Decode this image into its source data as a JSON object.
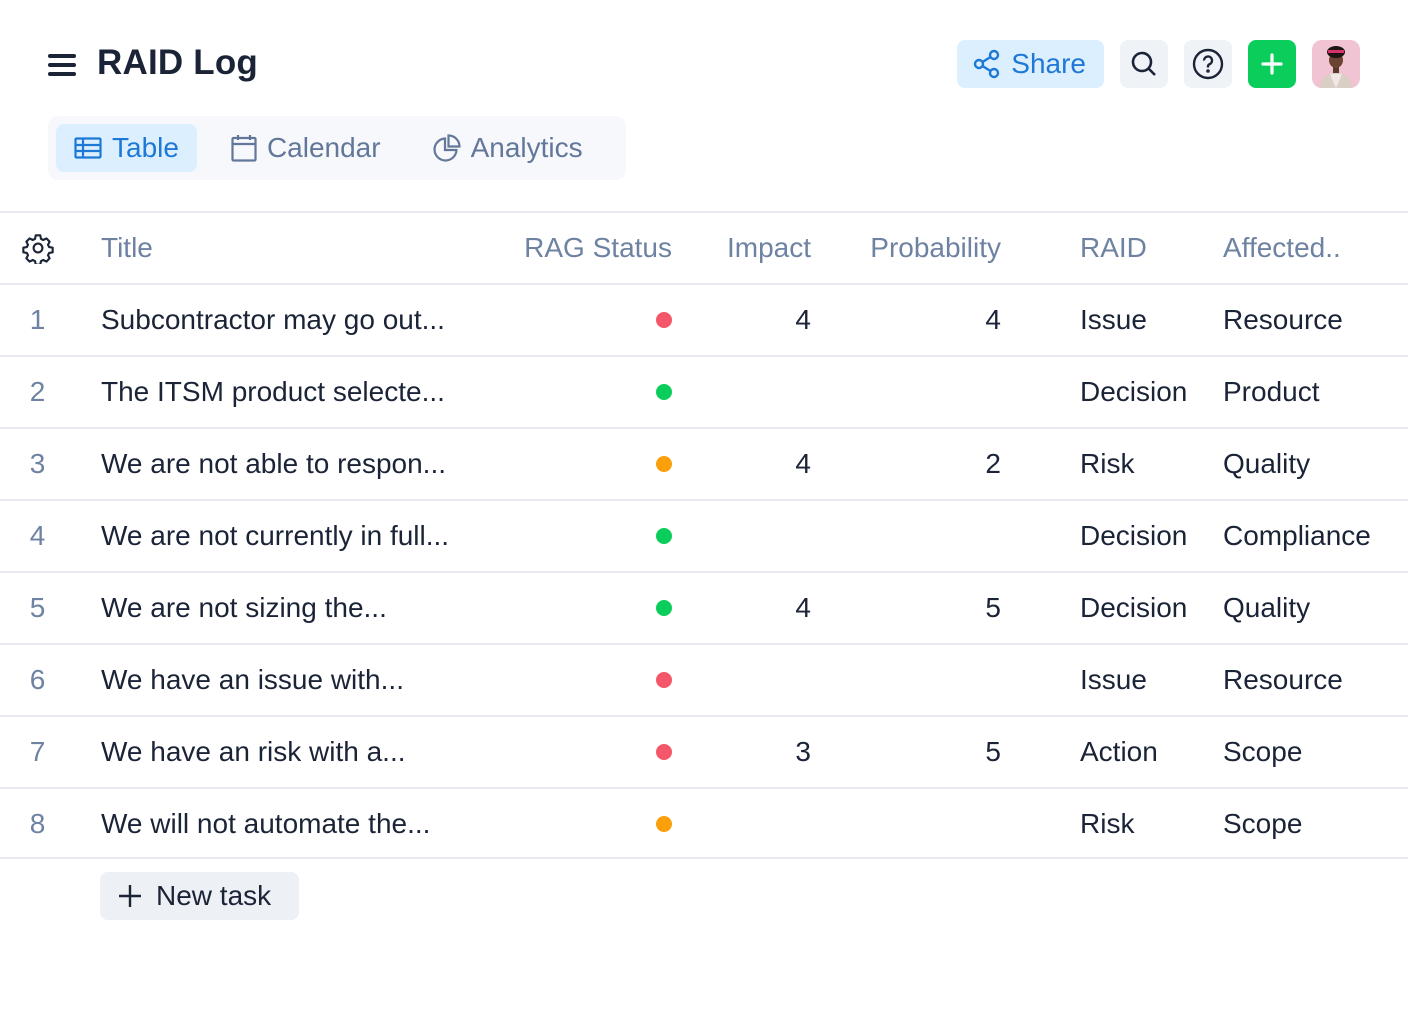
{
  "header": {
    "title": "RAID Log",
    "menu_icon": "hamburger-menu-icon",
    "share_label": "Share",
    "share_icon": "share-icon",
    "search_icon": "search-icon",
    "help_icon": "help-circle-icon",
    "add_icon": "plus-icon",
    "avatar": "user-avatar"
  },
  "tabs": [
    {
      "label": "Table",
      "icon": "table-icon",
      "active": true
    },
    {
      "label": "Calendar",
      "icon": "calendar-icon",
      "active": false
    },
    {
      "label": "Analytics",
      "icon": "pie-chart-icon",
      "active": false
    }
  ],
  "table": {
    "settings_icon": "gear-icon",
    "columns": [
      "Title",
      "RAG Status",
      "Impact",
      "Probability",
      "RAID",
      "Affected.."
    ],
    "rows": [
      {
        "num": "1",
        "title": "Subcontractor may go out...",
        "rag": "red",
        "impact": "4",
        "probability": "4",
        "raid": "Issue",
        "affected": "Resource"
      },
      {
        "num": "2",
        "title": "The ITSM product selecte...",
        "rag": "green",
        "impact": "",
        "probability": "",
        "raid": "Decision",
        "affected": "Product"
      },
      {
        "num": "3",
        "title": "We are not able to respon...",
        "rag": "amber",
        "impact": "4",
        "probability": "2",
        "raid": "Risk",
        "affected": "Quality"
      },
      {
        "num": "4",
        "title": "We are not currently in full...",
        "rag": "green",
        "impact": "",
        "probability": "",
        "raid": "Decision",
        "affected": "Compliance"
      },
      {
        "num": "5",
        "title": "We are not sizing the...",
        "rag": "green",
        "impact": "4",
        "probability": "5",
        "raid": "Decision",
        "affected": "Quality"
      },
      {
        "num": "6",
        "title": "We have an issue with...",
        "rag": "red",
        "impact": "",
        "probability": "",
        "raid": "Issue",
        "affected": "Resource"
      },
      {
        "num": "7",
        "title": "We have an risk with a...",
        "rag": "red",
        "impact": "3",
        "probability": "5",
        "raid": "Action",
        "affected": "Scope"
      },
      {
        "num": "8",
        "title": "We will not automate the...",
        "rag": "amber",
        "impact": "",
        "probability": "",
        "raid": "Risk",
        "affected": "Scope"
      }
    ]
  },
  "new_task_label": "New task",
  "colors": {
    "accent": "#1d78d6",
    "add_green": "#0bcd5b",
    "rag_red": "#f4566a",
    "rag_green": "#0bcd5b",
    "rag_amber": "#fb9f0a"
  }
}
